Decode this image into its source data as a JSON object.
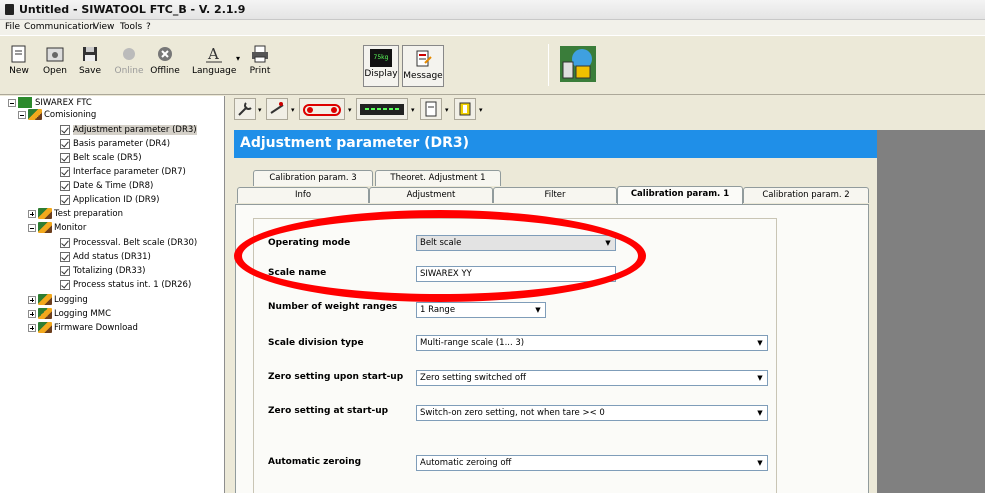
{
  "window": {
    "title": "Untitled - SIWATOOL FTC_B - V. 2.1.9"
  },
  "menu": [
    "File",
    "Communication",
    "View",
    "Tools",
    "?"
  ],
  "toolbar": {
    "new": "New",
    "open": "Open",
    "save": "Save",
    "online": "Online",
    "offline": "Offline",
    "language": "Language",
    "print": "Print",
    "display": "Display",
    "message": "Message",
    "display_badge": "75kg"
  },
  "tree": {
    "root": "SIWAREX FTC",
    "commissioning": "Comisioning",
    "commissioning_items": [
      "Adjustment parameter (DR3)",
      "Basis parameter (DR4)",
      "Belt scale (DR5)",
      "Interface parameter (DR7)",
      "Date & Time (DR8)",
      "Application ID (DR9)"
    ],
    "test_preparation": "Test preparation",
    "monitor": "Monitor",
    "monitor_items": [
      "Processval. Belt scale (DR30)",
      "Add status (DR31)",
      "Totalizing (DR33)",
      "Process status int. 1 (DR26)"
    ],
    "logging": "Logging",
    "logging_mmc": "Logging MMC",
    "firmware": "Firmware Download"
  },
  "page_title": "Adjustment parameter (DR3)",
  "tabs_back": [
    "Calibration param. 3",
    "Theoret. Adjustment 1"
  ],
  "tabs_front": [
    "Info",
    "Adjustment",
    "Filter",
    "Calibration param. 1",
    "Calibration param. 2"
  ],
  "form": {
    "operating_mode": {
      "label": "Operating mode",
      "value": "Belt scale"
    },
    "scale_name": {
      "label": "Scale name",
      "value": "SIWAREX YY"
    },
    "weight_ranges": {
      "label": "Number of weight ranges",
      "value": "1 Range"
    },
    "division_type": {
      "label": "Scale division type",
      "value": "Multi-range scale (1... 3)"
    },
    "zero_upon_startup": {
      "label": "Zero setting upon start-up",
      "value": "Zero setting switched off"
    },
    "zero_at_startup": {
      "label": "Zero setting at start-up",
      "value": "Switch-on zero setting, not when tare >< 0"
    },
    "auto_zero": {
      "label": "Automatic zeroing",
      "value": "Automatic zeroing off"
    }
  },
  "colors": {
    "banner": "#1f8fe8",
    "annotation": "#ff0000"
  }
}
